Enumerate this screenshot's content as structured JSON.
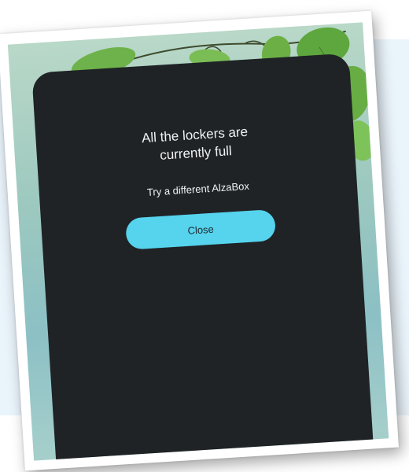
{
  "dialog": {
    "title": "All the lockers are currently full",
    "message": "Try a different AlzaBox",
    "close_label": "Close"
  },
  "colors": {
    "device_background": "#1f2326",
    "button_accent": "#56d3ed",
    "outer_panel": "#eaf4fb"
  }
}
